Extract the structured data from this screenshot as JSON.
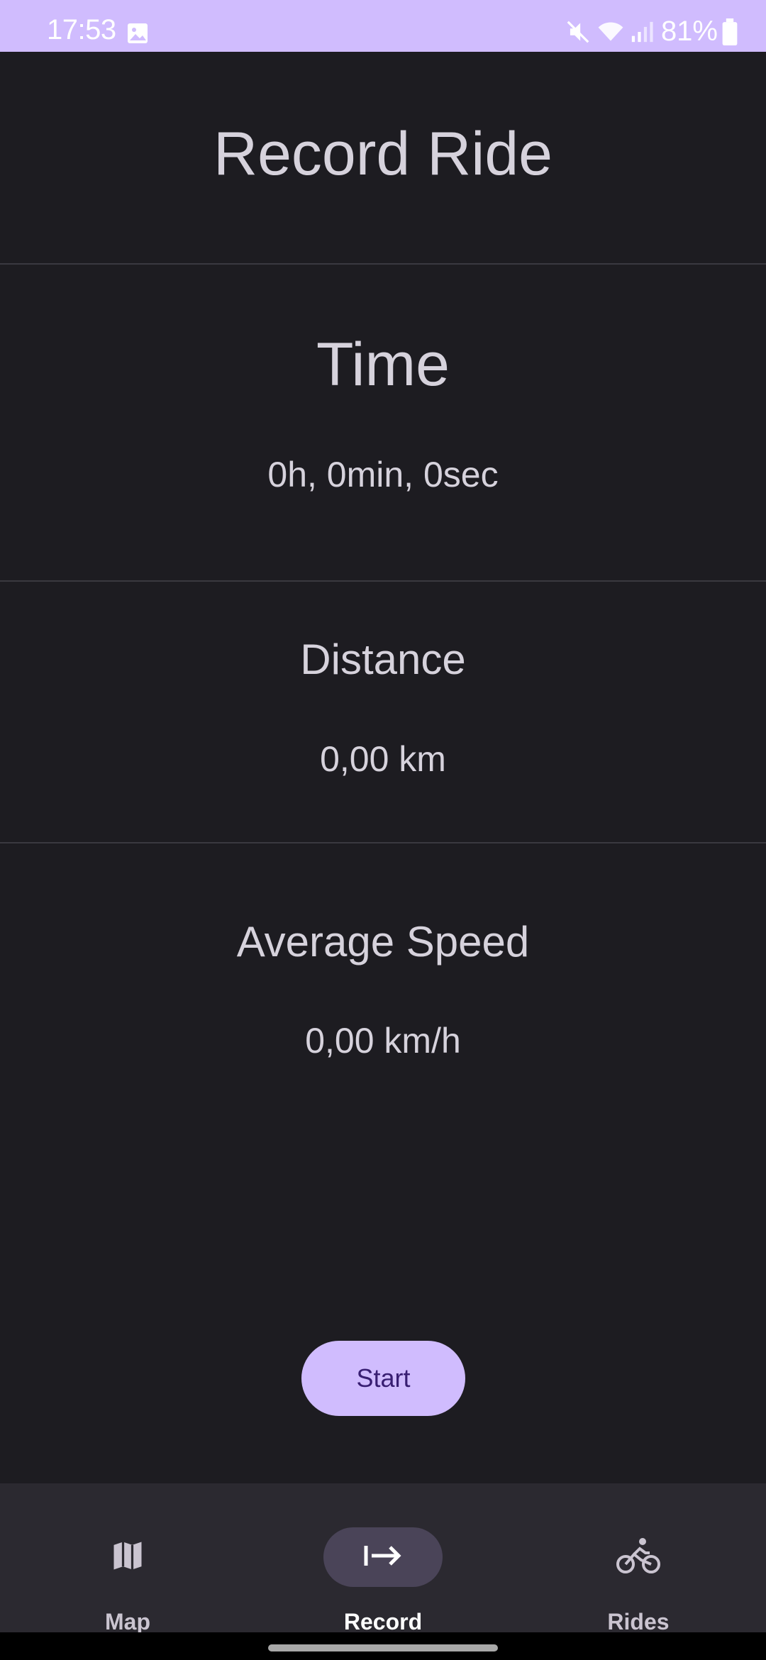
{
  "status_bar": {
    "time": "17:53",
    "battery": "81%",
    "icons": [
      "gallery-icon",
      "mute-icon",
      "wifi-icon",
      "signal-icon",
      "battery-icon"
    ]
  },
  "header": {
    "title": "Record Ride"
  },
  "stats": {
    "time": {
      "label": "Time",
      "value": "0h, 0min, 0sec"
    },
    "distance": {
      "label": "Distance",
      "value": "0,00 km"
    },
    "average_speed": {
      "label": "Average Speed",
      "value": "0,00 km/h"
    }
  },
  "actions": {
    "start_label": "Start"
  },
  "bottom_nav": {
    "items": [
      {
        "label": "Map",
        "icon": "map-icon",
        "active": false
      },
      {
        "label": "Record",
        "icon": "arrow-right-to-line-icon",
        "active": true
      },
      {
        "label": "Rides",
        "icon": "bicycle-icon",
        "active": false
      }
    ]
  },
  "colors": {
    "background": "#1d1c21",
    "accent": "#d0bcfe",
    "nav_background": "#2b2930",
    "nav_active_indicator": "#4a4458"
  }
}
